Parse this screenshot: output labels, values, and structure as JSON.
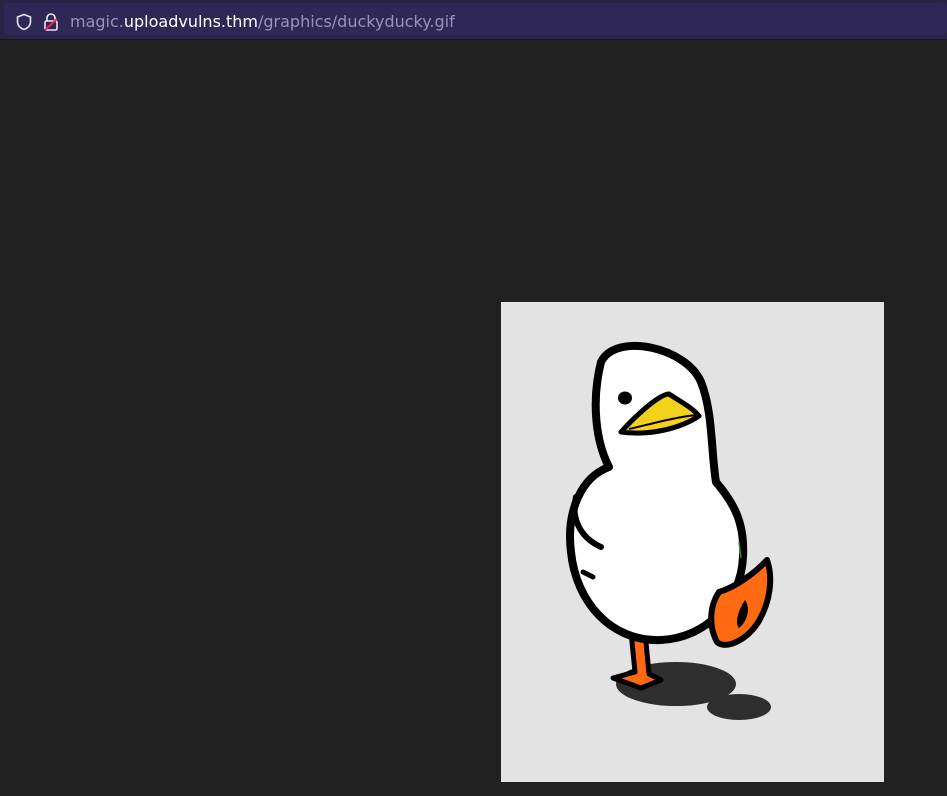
{
  "browser": {
    "url_prefix": "magic.",
    "url_host": "uploadvulns.thm",
    "url_path": "/graphics/duckyducky.gif",
    "icons": [
      "shield-icon",
      "insecure-lock-icon"
    ]
  },
  "page": {
    "background": "#212121",
    "image": {
      "subject": "duck-illustration",
      "background": "#e3e3e3"
    }
  },
  "colors": {
    "urlbar_bg": "#2b2346",
    "urlbox_bg": "#2f2856",
    "host_text": "#ffffff",
    "dim_text": "#9a93b6",
    "duck_beak": "#f2d21b",
    "duck_feet": "#ff6a13"
  }
}
